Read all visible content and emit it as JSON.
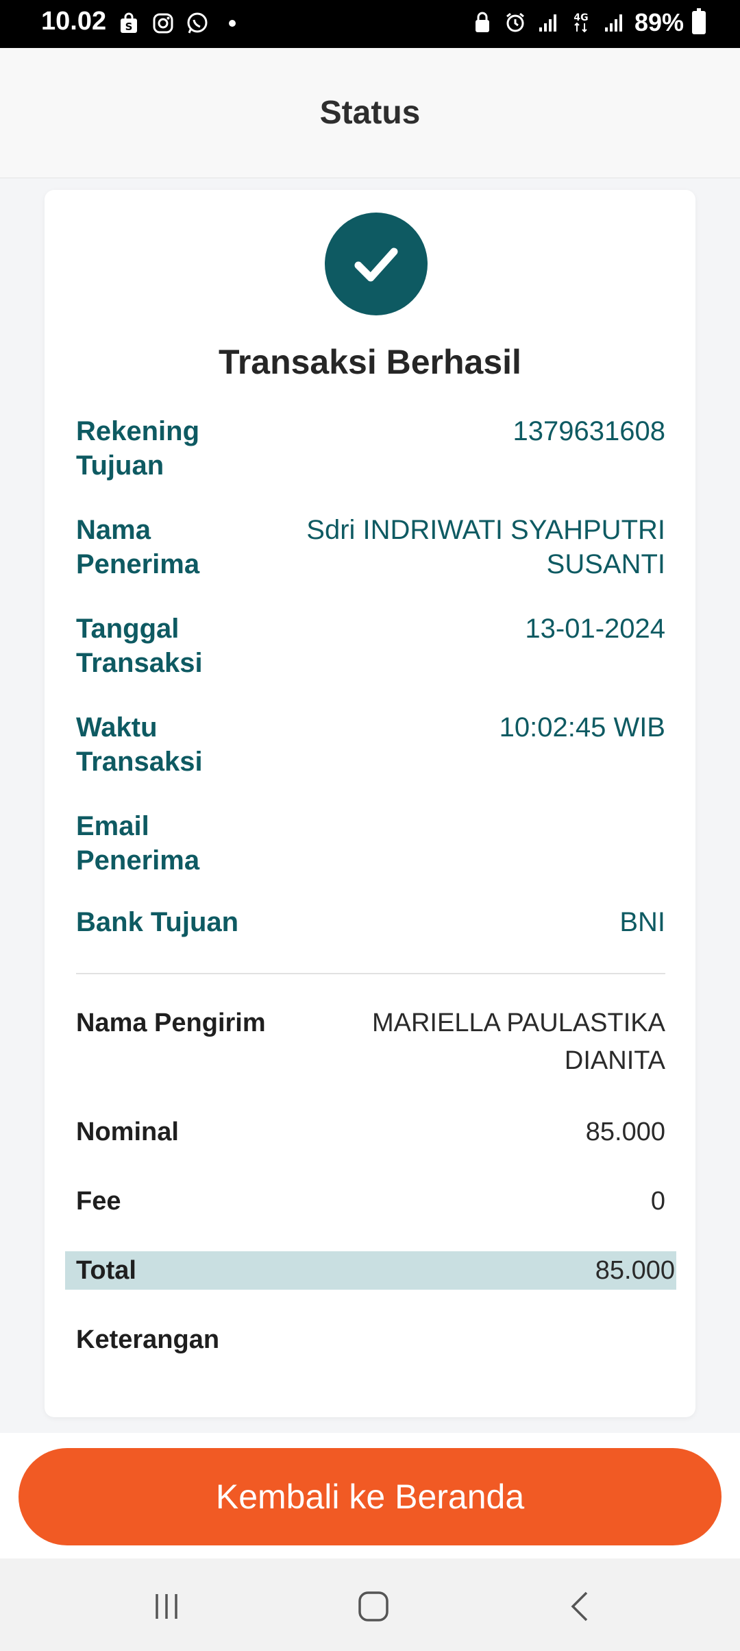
{
  "status_bar": {
    "time": "10.02",
    "battery": "89%",
    "left_icons": [
      "shopee-icon",
      "instagram-icon",
      "whatsapp-icon",
      "dot-icon"
    ],
    "right_icons": [
      "lock-icon",
      "alarm-icon",
      "signal-icon",
      "4g-icon",
      "signal-icon",
      "battery-icon"
    ]
  },
  "header": {
    "title": "Status"
  },
  "result": {
    "icon": "check-icon",
    "title": "Transaksi Berhasil",
    "accent_color": "#0e5a62"
  },
  "details": [
    {
      "label": "Rekening Tujuan",
      "value": "1379631608"
    },
    {
      "label": "Nama Penerima",
      "value": "Sdri INDRIWATI SYAHPUTRI SUSANTI"
    },
    {
      "label": "Tanggal Transaksi",
      "value": "13-01-2024"
    },
    {
      "label": "Waktu Transaksi",
      "value": "10:02:45 WIB"
    },
    {
      "label": "Email Penerima",
      "value": ""
    },
    {
      "label": "Bank Tujuan",
      "value": "BNI"
    }
  ],
  "summary": {
    "sender": {
      "label": "Nama Pengirim",
      "value": "MARIELLA PAULASTIKA DIANITA"
    },
    "nominal": {
      "label": "Nominal",
      "value": "85.000"
    },
    "fee": {
      "label": "Fee",
      "value": "0"
    },
    "total": {
      "label": "Total",
      "value": "85.000"
    },
    "note": {
      "label": "Keterangan",
      "value": ""
    }
  },
  "button": {
    "label": "Kembali ke Beranda",
    "color": "#f15a24"
  },
  "nav": {
    "icons": [
      "recent-apps-icon",
      "home-icon",
      "back-icon"
    ]
  }
}
